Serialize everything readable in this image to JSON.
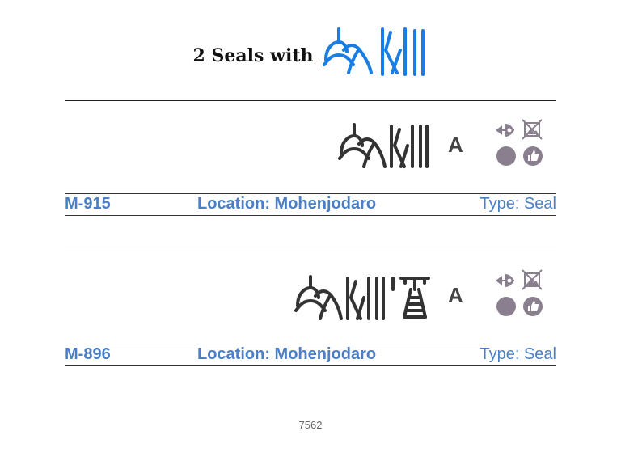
{
  "header": {
    "title": "2 Seals with",
    "sign_color": "#1a7de3"
  },
  "seals": [
    {
      "id": "M-915",
      "location": "Location: Mohenjodaro",
      "type": "Type: Seal",
      "variant": "A",
      "sign_count": 2
    },
    {
      "id": "M-896",
      "location": "Location: Mohenjodaro",
      "type": "Type: Seal",
      "variant": "A",
      "sign_count": 3
    }
  ],
  "icons": [
    "direction-eye-icon",
    "no-image-icon",
    "circle-icon",
    "thumbs-up-icon"
  ],
  "colors": {
    "link_blue": "#4a7fc7",
    "icon_gray": "#8a7f8f",
    "sign_dark": "#333333"
  },
  "footer": {
    "page_number": "7562"
  }
}
